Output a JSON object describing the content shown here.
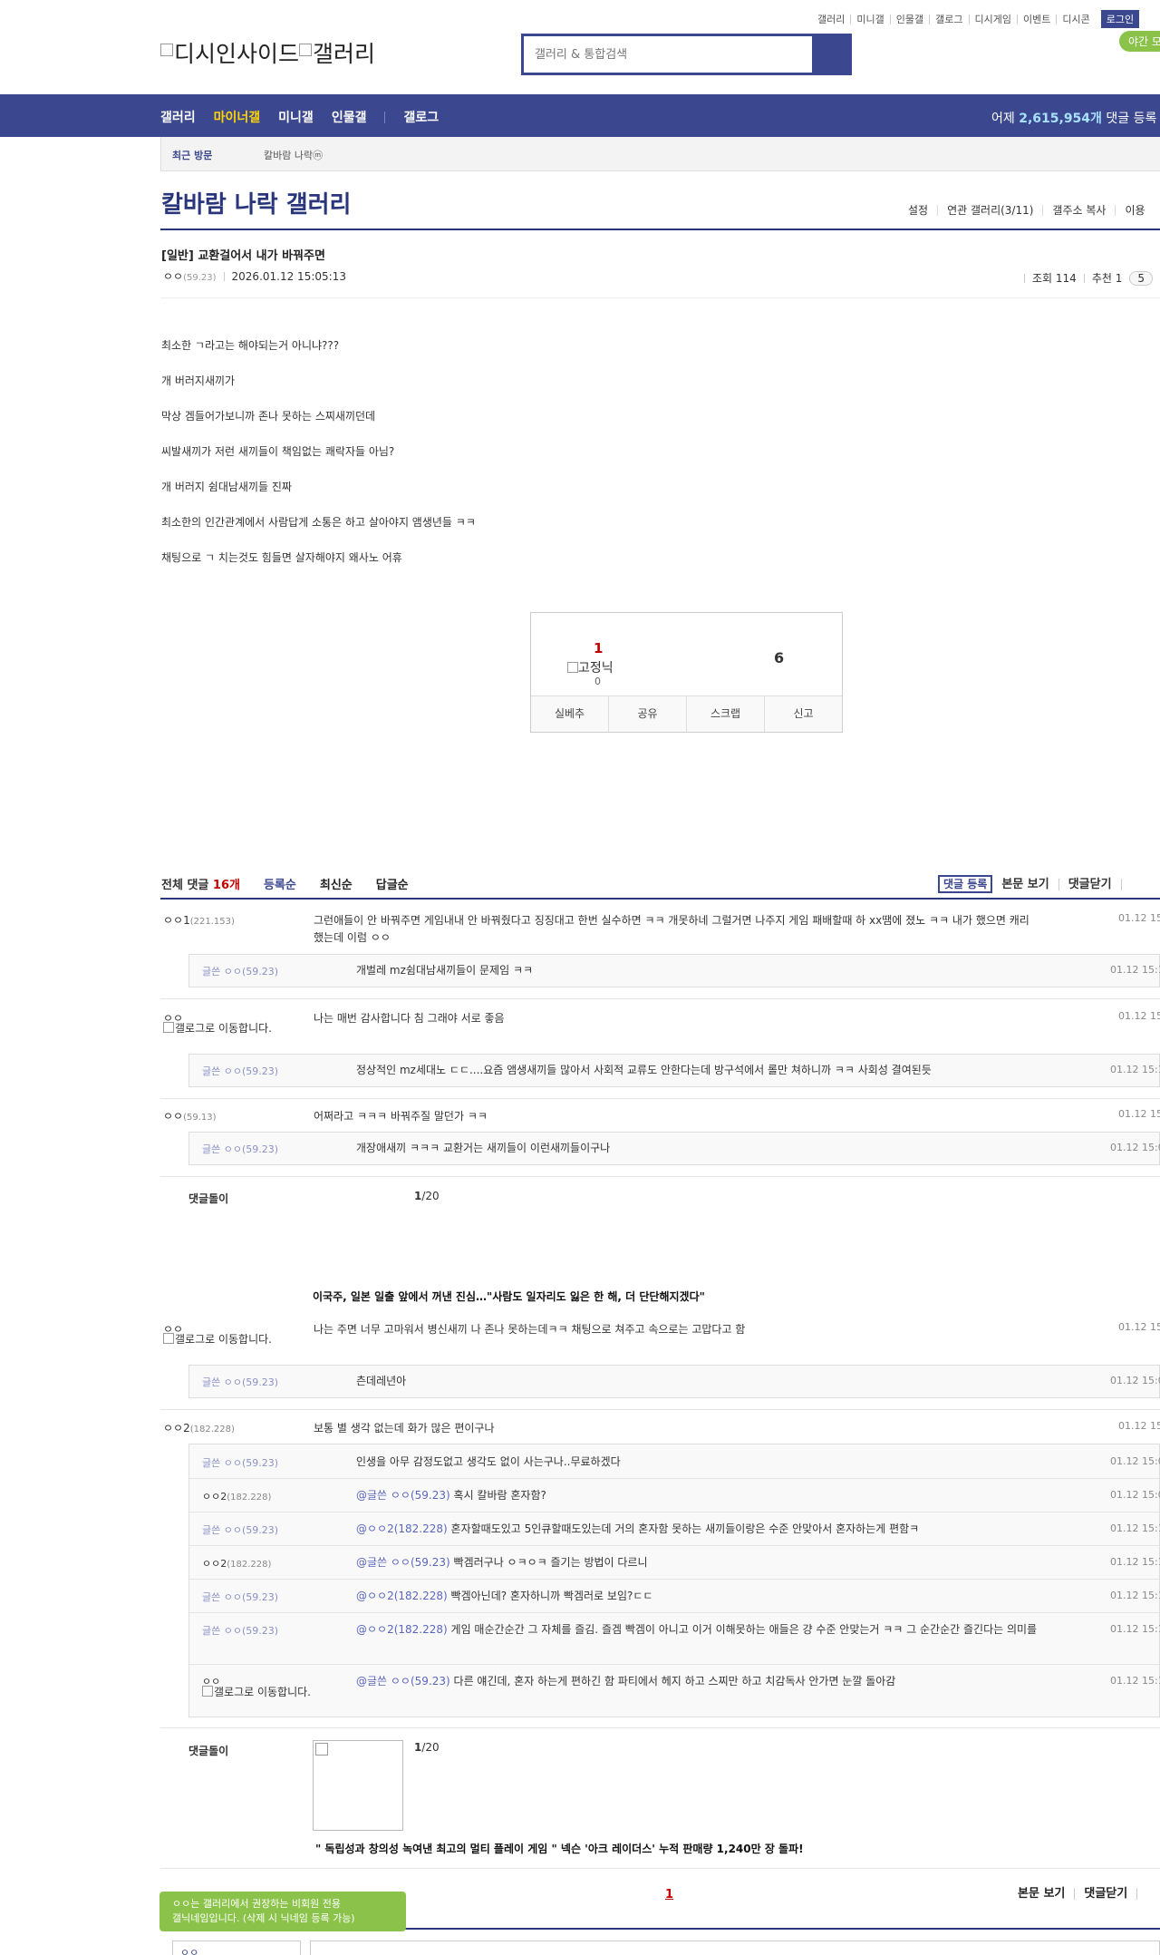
{
  "top_links": [
    "갤러리",
    "미니갤",
    "인물갤",
    "갤로그",
    "디시게임",
    "이벤트",
    "디시콘"
  ],
  "login": "로그인",
  "night_mode": "야간 모",
  "logo": {
    "part1": "디시인사이드",
    "part2": "갤러리"
  },
  "search": {
    "placeholder": "갤러리 & 통합검색"
  },
  "nav": {
    "items": [
      "갤러리",
      "마이너갤",
      "미니갤",
      "인물갤"
    ],
    "gallog": "갤로그",
    "stat_prefix": "어제",
    "stat_value": "2,615,954개",
    "stat_suffix": "댓글 등록"
  },
  "recent": {
    "label": "최근 방문",
    "item": "칼바람 나락ⓜ"
  },
  "gallery": {
    "title": "칼바람 나락 갤러리",
    "tools": [
      "설정",
      "연관 갤러리(3/11)",
      "갤주소 복사",
      "이용"
    ]
  },
  "post": {
    "title": "[일반] 교환걸어서 내가 바꿔주면",
    "author": "ㅇㅇ",
    "author_ip": "(59.23)",
    "date": "2026.01.12 15:05:13",
    "views": "조회 114",
    "recommend": "추천 1",
    "comment_pill": "5",
    "lines": [
      "최소한 ㄱ라고는 해야되는거 아니냐???",
      "개 버러지새끼가",
      "막상 겜들어가보니까 존나 못하는 스찌새끼던데",
      "씨발새끼가 저런 새끼들이 책임없는 쾌락자들 아님?",
      "개 버러지 쉼대남새끼들 진짜",
      "최소한의 인간관계에서 사람답게 소통은 하고 살아야지 앰생년들 ㅋㅋ",
      "채팅으로 ㄱ 치는것도 힘들면 살자해야지 왜사노 어휴"
    ]
  },
  "recommend_box": {
    "up": "1",
    "fixed_label": "고정닉",
    "fixed_count": "0",
    "down": "6",
    "actions": [
      "실베추",
      "공유",
      "스크랩",
      "신고"
    ]
  },
  "comments_header": {
    "label": "전체 댓글",
    "count": "16개",
    "sort": [
      "등록순",
      "최신순",
      "답글순"
    ],
    "register": "댓글 등록",
    "view_body": "본문 보기",
    "close": "댓글닫기"
  },
  "gallog_move": "갤로그로 이동합니다.",
  "comments": [
    {
      "author": "ㅇㅇ1",
      "ip": "(221.153)",
      "text": "그런애들이 안 바꿔주면 게임내내 안 바꿔줬다고 징징대고 한번 실수하면 ㅋㅋ 개못하네 그럴거면 나주지 게임 패배할때 하 xx땜에 졌노 ㅋㅋ 내가 했으면 캐리했는데 이럼 ㅇㅇ",
      "date": "01.12 15"
    },
    {
      "author": "ㅇㅇ",
      "text": "나는 매번 감사합니다 침 그래야 서로 좋음",
      "date": "01.12 15"
    },
    {
      "author": "ㅇㅇ",
      "ip": "(59.13)",
      "text": "어쩌라고 ㅋㅋㅋ 바꿔주질 말던가 ㅋㅋ",
      "date": "01.12 15"
    },
    {
      "author": "ㅇㅇ",
      "text": "나는 주면 너무 고마워서 병신새끼 나 존나 못하는데ㅋㅋ 채팅으로 쳐주고 속으로는 고맙다고 함",
      "date": "01.12 15"
    },
    {
      "author": "ㅇㅇ2",
      "ip": "(182.228)",
      "text": "보통 별 생각 없는데 화가 많은 편이구나",
      "date": "01.12 15"
    }
  ],
  "replies_op": {
    "prefix": "글쓴",
    "author": "ㅇㅇ",
    "ip": "(59.23)"
  },
  "replies": [
    {
      "text": "개벌레 mz쉼대남새끼들이 문제임 ㅋㅋ",
      "date": "01.12 15:1"
    },
    {
      "text": "정상적인 mz세대노 ㄷㄷ....요즘 앰생새끼들 많아서 사회적 교류도 안한다는데 방구석에서 롤만 쳐하니까 ㅋㅋ 사회성 결여된듯",
      "date": "01.12 15:1"
    },
    {
      "text": "개장애새끼 ㅋㅋㅋ 교환거는 새끼들이 이런새끼들이구나",
      "date": "01.12 15:0"
    },
    {
      "text": "츤데레년아",
      "date": "01.12 15:0"
    },
    {
      "text": "인생을 아무 감정도없고 생각도 없이 사는구나..무료하겠다",
      "date": "01.12 15:0"
    },
    {
      "author": "ㅇㅇ2",
      "ip": "(182.228)",
      "at": "@글쓴 ㅇㅇ(59.23)",
      "text": "혹시 칼바람 혼자함?",
      "date": "01.12 15:0"
    },
    {
      "at": "@ㅇㅇ2(182.228)",
      "text": "혼자할때도있고 5인큐할때도있는데 거의 혼자함 못하는 새끼들이랑은 수준 안맞아서 혼자하는게 편함ㅋ",
      "date": "01.12 15:1"
    },
    {
      "author": "ㅇㅇ2",
      "ip": "(182.228)",
      "at": "@글쓴 ㅇㅇ(59.23)",
      "text": "빡겜러구나 ㅇㅋㅇㅋ 즐기는 방법이 다르니",
      "date": "01.12 15:1"
    },
    {
      "at": "@ㅇㅇ2(182.228)",
      "text": "빡겜아닌데? 혼자하니까 빡겜러로 보임?ㄷㄷ",
      "date": "01.12 15:1"
    },
    {
      "at": "@ㅇㅇ2(182.228)",
      "text": "게임 매순간순간 그 자체를 즐김. 즐겜 빡겜이 아니고 이거 이해못하는 애들은 걍 수준 안맞는거 ㅋㅋ 그 순간순간 즐긴다는 의미를",
      "date": "01.12 15:1"
    },
    {
      "author": "ㅇㅇ",
      "at": "@글쓴 ㅇㅇ(59.23)",
      "text": "다른 얘긴데, 혼자 하는게 편하긴 함 파티에서 헤지 하고 스찌만 하고 치감독사 안가면 눈깔 돌아감",
      "date": "01.12 15:1"
    }
  ],
  "comment_footer": {
    "label": "댓글돌이",
    "page": "1",
    "total": "/20"
  },
  "ads": {
    "headline1": "이국주, 일본 일출 앞에서 꺼낸 진심…\"사람도 일자리도 잃은 한 해, 더 단단해지겠다\"",
    "headline2": "\" 독립성과 창의성 녹여낸 최고의 멀티 플레이 게임 \"  넥슨 '아크 레이더스' 누적 판매량 1,240만 장 돌파!"
  },
  "bottom": {
    "page": "1",
    "view_body": "본문 보기",
    "close": "댓글닫기"
  },
  "tooltip": {
    "line1": "ㅇㅇ는 갤러리에서 권장하는 비회원 전용",
    "line2": "갤닉네임입니다. (삭제 시 닉네임 등록 가능)"
  },
  "write": {
    "nick": "ㅇㅇ"
  },
  "colors": {
    "brand": "#3b4890",
    "accent_yellow": "#ffd400",
    "red": "#c20000",
    "green": "#8bc34a"
  }
}
